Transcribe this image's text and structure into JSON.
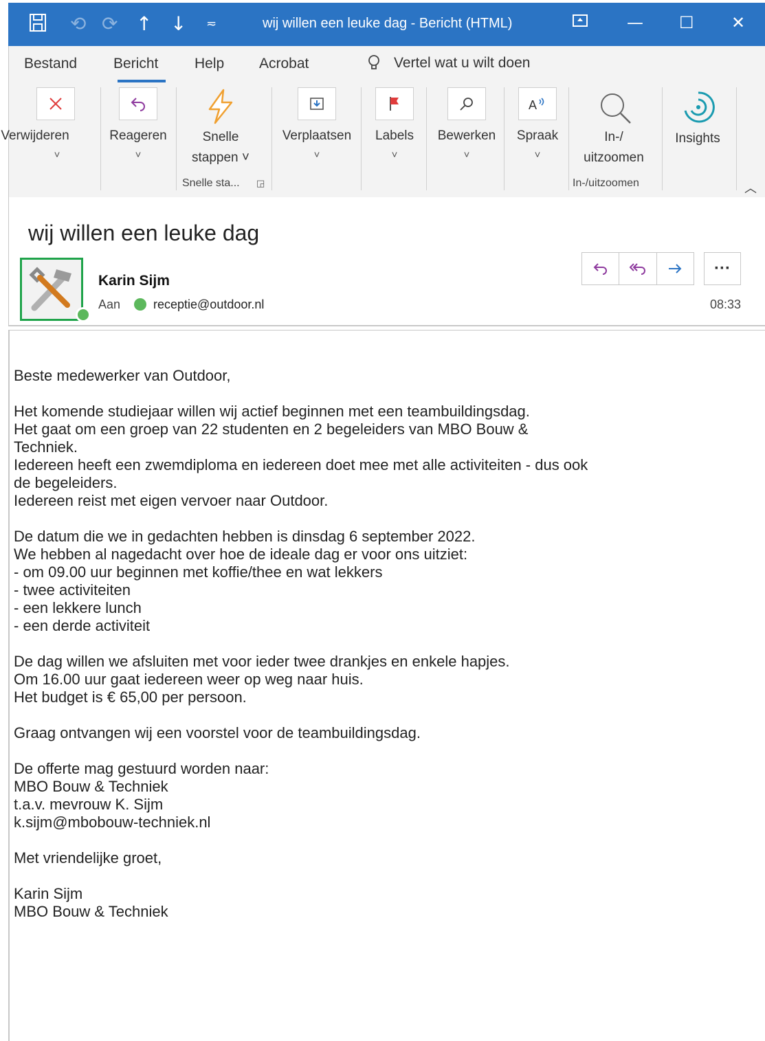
{
  "titlebar": {
    "title": "wij willen een leuke dag  -  Bericht (HTML)",
    "icons": [
      "save-icon",
      "undo-icon",
      "redo-icon",
      "up-arrow-icon",
      "down-arrow-icon",
      "customize-icon",
      "ribbon-display-icon",
      "minimize-icon",
      "maximize-icon",
      "close-icon"
    ]
  },
  "tabs": [
    "Bestand",
    "Bericht",
    "Help",
    "Acrobat"
  ],
  "tell_me": "Vertel wat u wilt doen",
  "ribbon": {
    "verwijderen": "Verwijderen",
    "reageren": "Reageren",
    "snelle_1": "Snelle",
    "snelle_2": "stappen ˅",
    "verplaatsen": "Verplaatsen",
    "labels": "Labels",
    "bewerken": "Bewerken",
    "spraak": "Spraak",
    "zoom_1": "In-/",
    "zoom_2": "uitzoomen",
    "insights": "Insights",
    "group_snelle": "Snelle sta...",
    "group_zoom": "In-/uitzoomen"
  },
  "message": {
    "subject": "wij willen een leuke dag",
    "sender": "Karin Sijm",
    "to_label": "Aan",
    "to_address": "receptie@outdoor.nl",
    "time": "08:33",
    "more": "···"
  },
  "body_lines": [
    "Beste medewerker van Outdoor,",
    "",
    "Het komende studiejaar willen wij actief beginnen met een teambuildingsdag.",
    "Het gaat om een groep van 22 studenten en 2 begeleiders van MBO Bouw &",
    "Techniek.",
    "Iedereen heeft een zwemdiploma en iedereen doet mee met alle activiteiten - dus ook",
    "de begeleiders.",
    "Iedereen reist met eigen vervoer naar Outdoor.",
    "",
    "De datum die we in gedachten hebben is dinsdag 6 september 2022.",
    "We hebben al nagedacht over hoe de ideale dag er voor ons uitziet:",
    "- om 09.00 uur beginnen met koffie/thee en wat lekkers",
    "- twee activiteiten",
    "- een lekkere lunch",
    "- een derde activiteit",
    "",
    "De dag willen we afsluiten met voor ieder twee drankjes en enkele hapjes.",
    "Om 16.00 uur gaat iedereen weer op weg naar huis.",
    "Het budget is € 65,00 per persoon.",
    "",
    "Graag ontvangen wij een voorstel voor de teambuildingsdag.",
    "",
    "De offerte mag gestuurd worden naar:",
    "MBO Bouw & Techniek",
    "t.a.v. mevrouw K. Sijm",
    "k.sijm@mbobouw-techniek.nl",
    "",
    "Met vriendelijke groet,",
    "",
    "Karin Sijm",
    "MBO Bouw & Techniek"
  ],
  "colors": {
    "titlebar": "#2b74c4",
    "ribbon": "#f3f3f3",
    "accent_red": "#e03c3c",
    "accent_purple": "#8e3a9e",
    "accent_orange": "#f0a030",
    "presence_green": "#5cb85c",
    "avatar_border": "#1fa34a"
  }
}
